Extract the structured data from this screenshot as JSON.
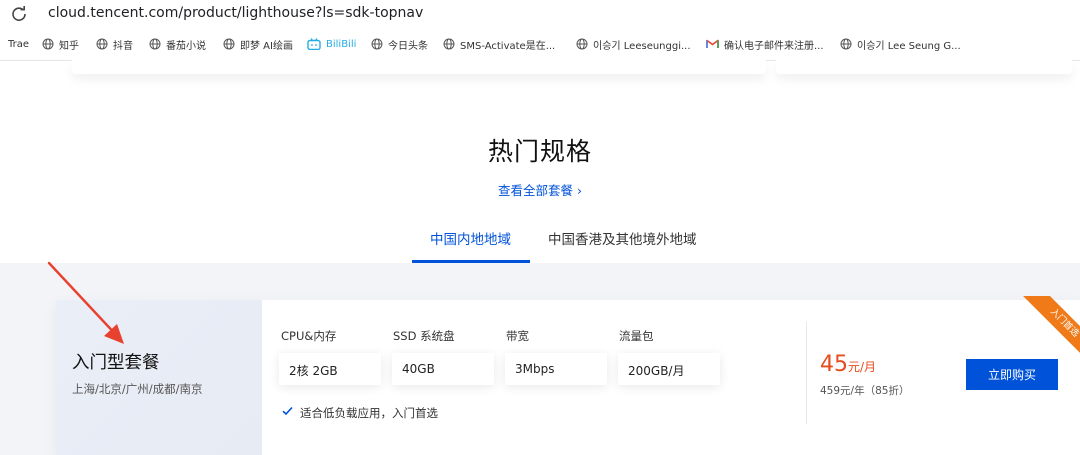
{
  "browser": {
    "url": "cloud.tencent.com/product/lighthouse?ls=sdk-topnav"
  },
  "bookmarks": [
    {
      "label": "Trae",
      "icon": "none"
    },
    {
      "label": "知乎",
      "icon": "globe-icon"
    },
    {
      "label": "抖音",
      "icon": "globe-icon"
    },
    {
      "label": "番茄小说",
      "icon": "globe-icon"
    },
    {
      "label": "即梦 AI绘画",
      "icon": "globe-icon"
    },
    {
      "label": "BiliBili",
      "icon": "bilibili-icon"
    },
    {
      "label": "今日头条",
      "icon": "globe-icon"
    },
    {
      "label": "SMS-Activate是在...",
      "icon": "globe-icon"
    },
    {
      "label": "이승기 Leeseunggi...",
      "icon": "globe-icon"
    },
    {
      "label": "确认电子邮件来注册...",
      "icon": "gmail-icon"
    },
    {
      "label": "이승기 Lee Seung G...",
      "icon": "globe-icon"
    }
  ],
  "section": {
    "title": "热门规格",
    "view_all": "查看全部套餐 ›"
  },
  "tabs": [
    {
      "label": "中国内地地域",
      "active": true
    },
    {
      "label": "中国香港及其他境外地域",
      "active": false
    }
  ],
  "package": {
    "name": "入门型套餐",
    "regions": "上海/北京/广州/成都/南京",
    "specs": [
      {
        "label": "CPU&内存",
        "value": "2核 2GB"
      },
      {
        "label": "SSD 系统盘",
        "value": "40GB"
      },
      {
        "label": "带宽",
        "value": "3Mbps"
      },
      {
        "label": "流量包",
        "value": "200GB/月"
      }
    ],
    "feature": "适合低负载应用，入门首选",
    "price": "45",
    "price_unit": "元/月",
    "yearly": "459元/年（85折）",
    "buy_label": "立即购买",
    "ribbon": "入门首选"
  },
  "colors": {
    "accent": "#0052d9",
    "price": "#e54d1c",
    "ribbon": "#f07a18",
    "arrow": "#e8412f"
  }
}
